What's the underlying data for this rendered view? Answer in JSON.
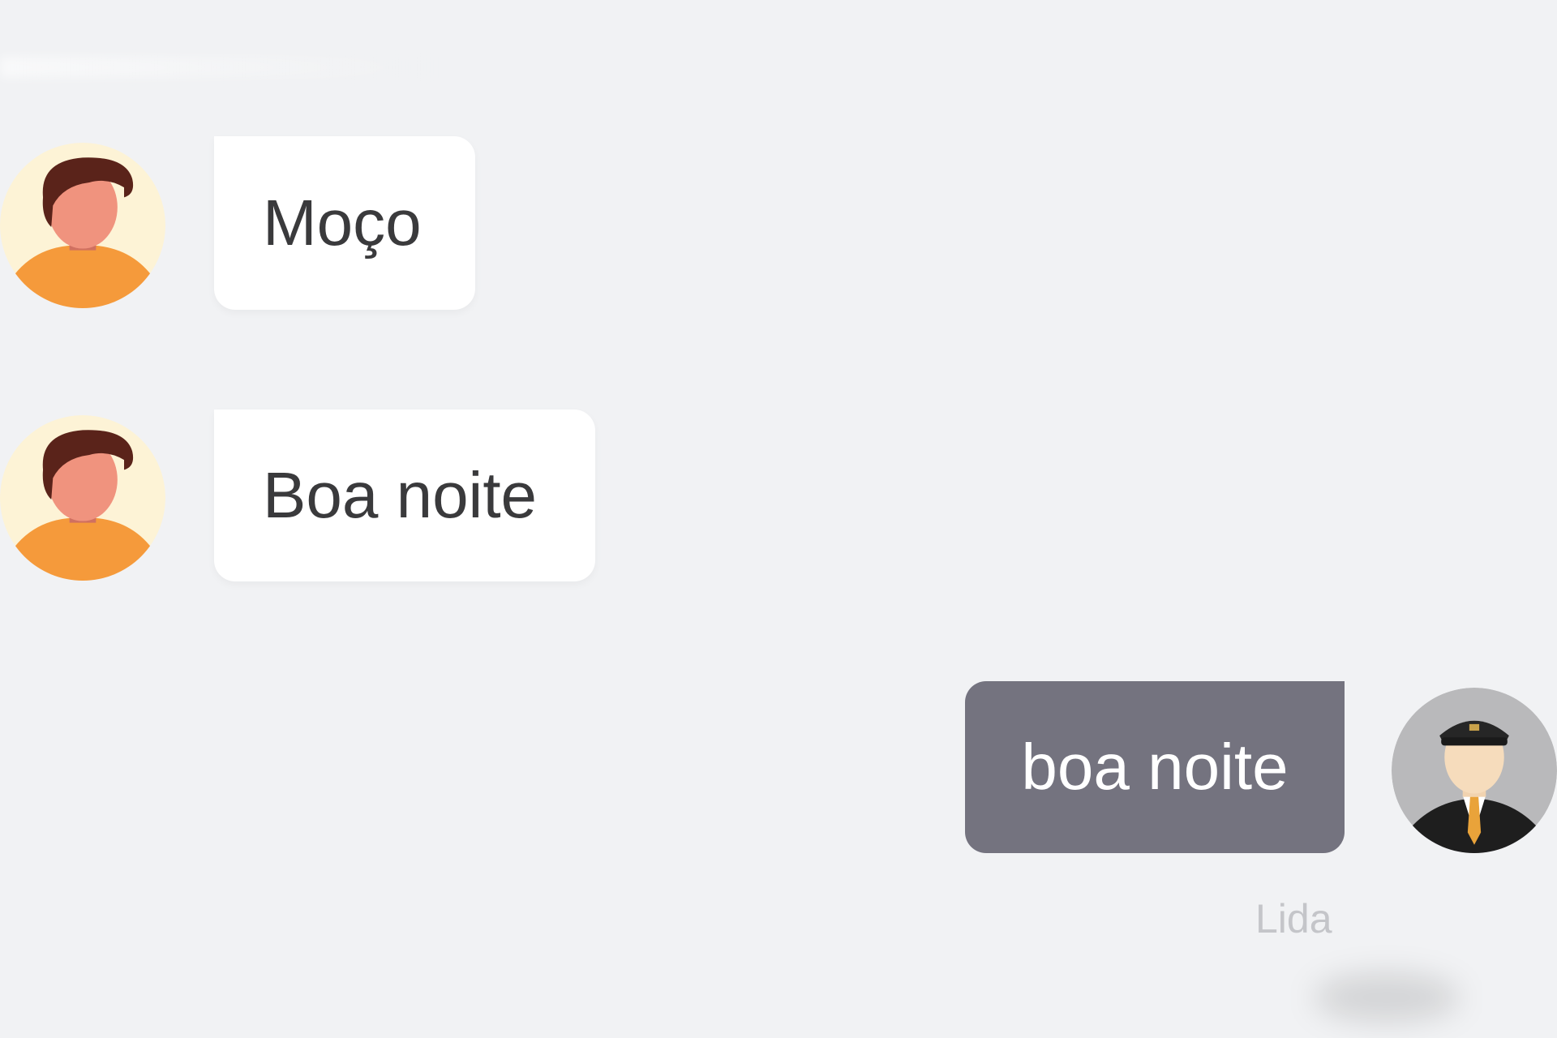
{
  "messages": [
    {
      "direction": "incoming",
      "text": "Moço",
      "avatar": "person-avatar"
    },
    {
      "direction": "incoming",
      "text": "Boa noite",
      "avatar": "person-avatar"
    },
    {
      "direction": "outgoing",
      "text": "boa noite",
      "avatar": "driver-avatar",
      "status": "Lida"
    }
  ],
  "colors": {
    "background": "#f1f2f4",
    "incoming_bubble": "#ffffff",
    "outgoing_bubble": "#74737f",
    "status_text": "#c4c5c9"
  }
}
